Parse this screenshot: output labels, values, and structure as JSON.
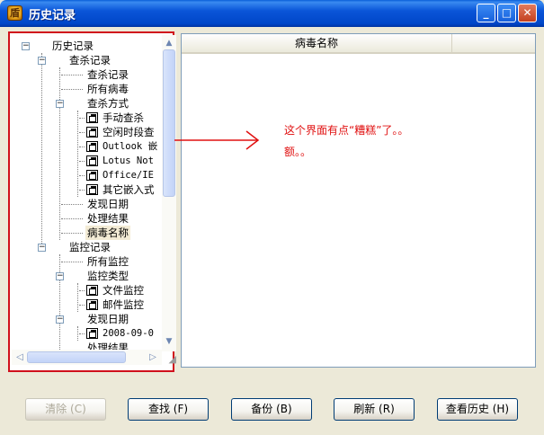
{
  "window": {
    "title": "历史记录",
    "icon": "shield-logo-icon",
    "controls": {
      "minimize": "_",
      "maximize": "□",
      "close": "✕"
    }
  },
  "tree": {
    "root": "历史记录",
    "scan_records": "查杀记录",
    "scan_records_child": "查杀记录",
    "all_viruses": "所有病毒",
    "scan_method": "查杀方式",
    "manual_scan": "手动查杀",
    "idle_scan": "空闲时段查",
    "outlook": "Outlook 嵌",
    "lotus": "Lotus Not",
    "office_ie": "Office/IE",
    "other_embedded": "其它嵌入式",
    "discover_date": "发现日期",
    "process_result": "处理结果",
    "virus_name": "病毒名称",
    "monitor_records": "监控记录",
    "all_monitors": "所有监控",
    "monitor_type": "监控类型",
    "file_monitor": "文件监控",
    "mail_monitor": "邮件监控",
    "monitor_discover_date": "发现日期",
    "date_entry": "2008-09-0",
    "monitor_process_result": "处理结果"
  },
  "list": {
    "column_header": "病毒名称"
  },
  "annotation": {
    "line1": "这个界面有点“糟糕”了。。",
    "line2": "额。。"
  },
  "buttons": {
    "clear": "清除 (C)",
    "find": "查找 (F)",
    "backup": "备份 (B)",
    "refresh": "刷新 (R)",
    "view_history": "查看历史 (H)"
  },
  "colors": {
    "annotation_red": "#e01010",
    "title_blue": "#0a55d8"
  }
}
